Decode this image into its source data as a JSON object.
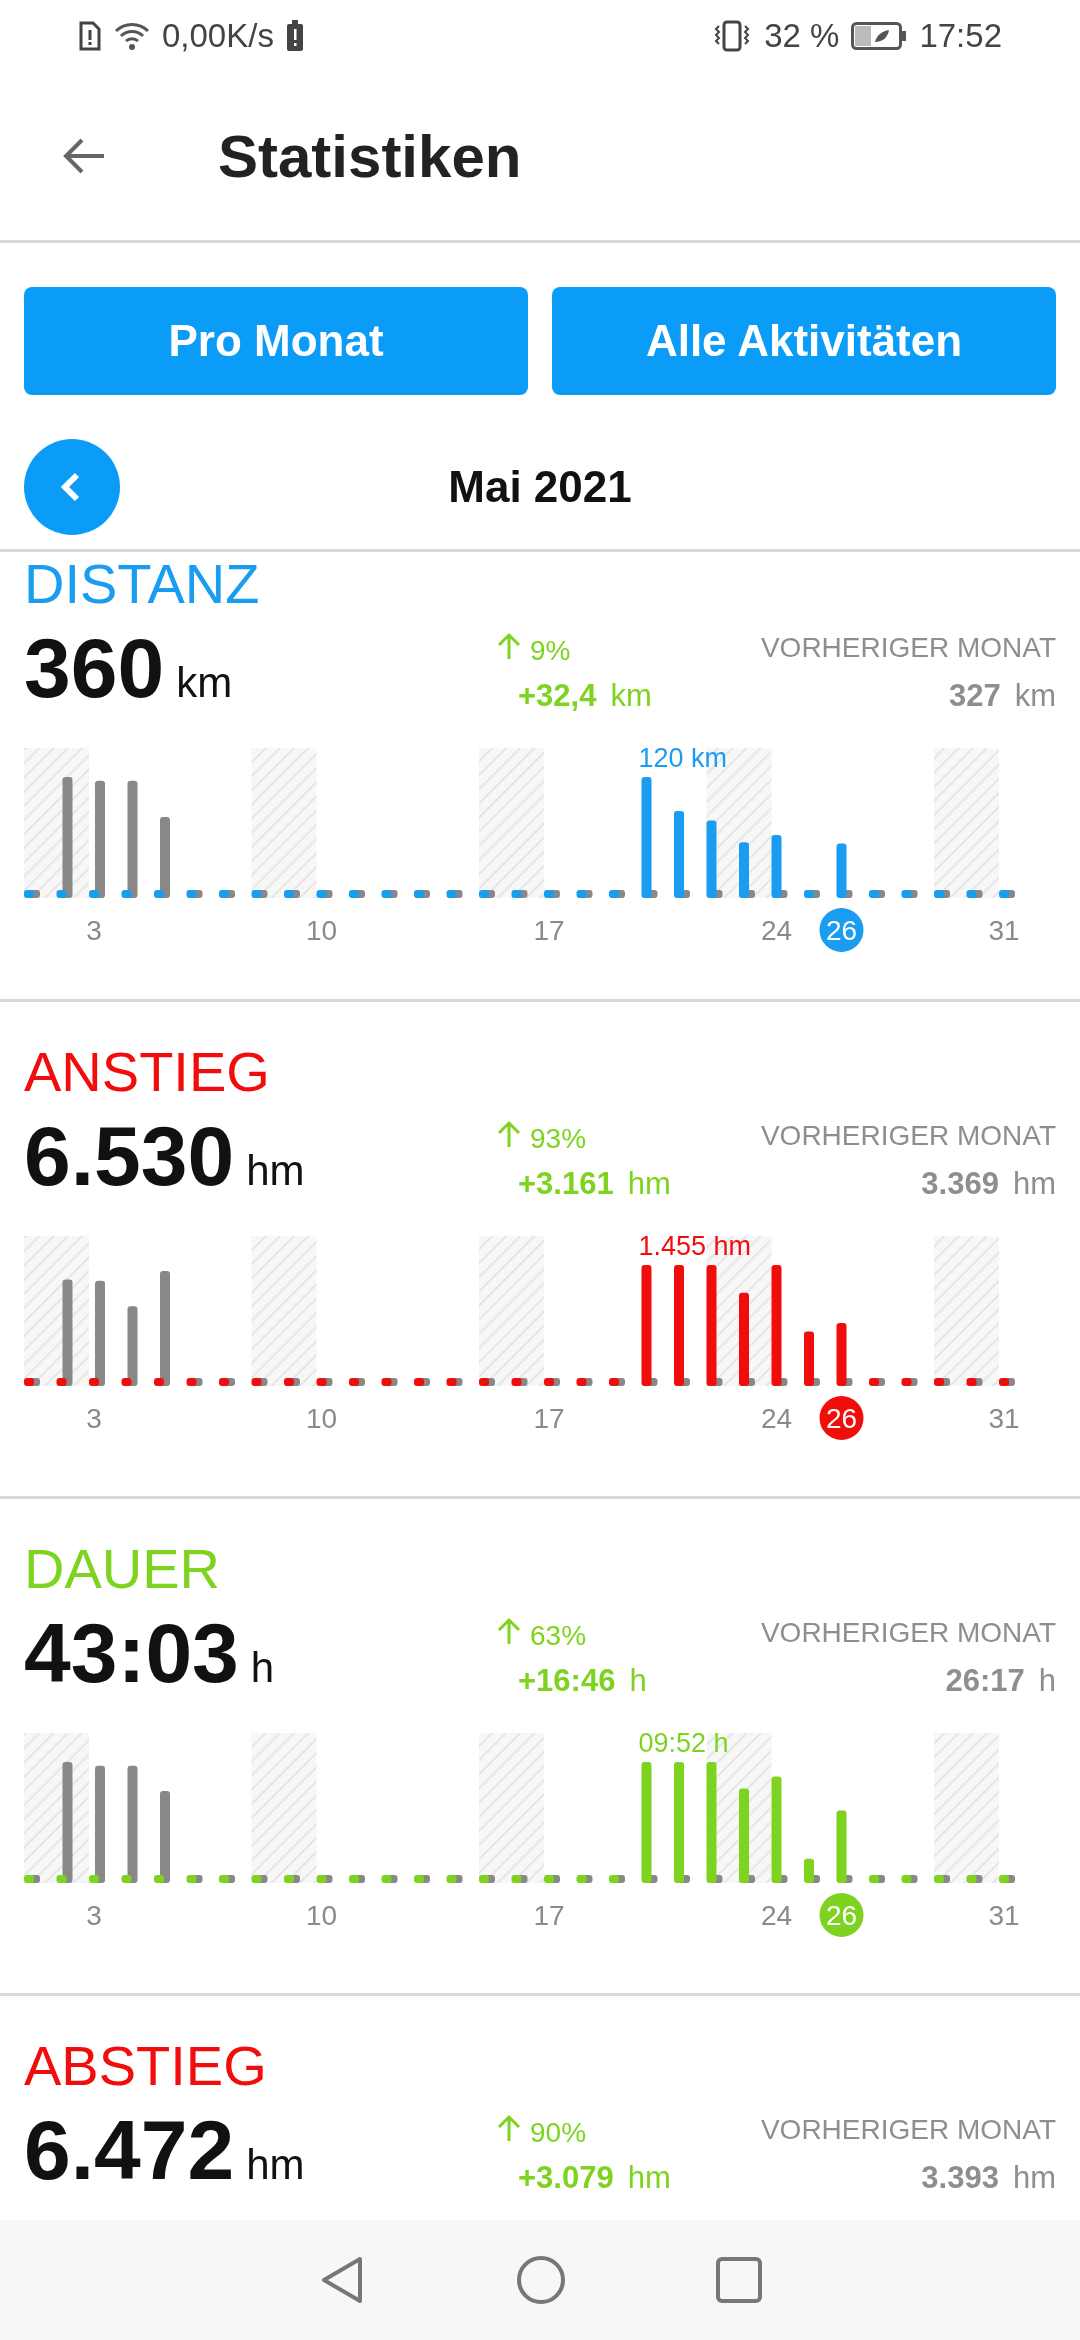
{
  "status_bar": {
    "net_speed": "0,00K/s",
    "battery": "32 %",
    "time": "17:52"
  },
  "app_bar": {
    "title": "Statistiken"
  },
  "buttons": [
    {
      "label": "Pro Monat"
    },
    {
      "label": "Alle Aktivitäten"
    }
  ],
  "period": {
    "label": "Mai 2021"
  },
  "sections": [
    {
      "title": "DISTANZ",
      "color": "#1a9cf0",
      "value": "360",
      "unit": "km",
      "change_pct": "9%",
      "change_value": "+32,4",
      "change_unit": "km",
      "previous_label": "VORHERIGER MONAT",
      "previous_value": "327",
      "previous_unit": "km",
      "peak_label": "120 km",
      "ticks": [
        {
          "label": "3",
          "selected": false
        },
        {
          "label": "10",
          "selected": false
        },
        {
          "label": "17",
          "selected": false
        },
        {
          "label": "24",
          "selected": false
        },
        {
          "label": "26",
          "selected": true
        },
        {
          "label": "31",
          "selected": false
        }
      ]
    },
    {
      "title": "ANSTIEG",
      "color": "#f20d0d",
      "value": "6.530",
      "unit": "hm",
      "change_pct": "93%",
      "change_value": "+3.161",
      "change_unit": "hm",
      "previous_label": "VORHERIGER MONAT",
      "previous_value": "3.369",
      "previous_unit": "hm",
      "peak_label": "1.455 hm",
      "ticks": [
        {
          "label": "3",
          "selected": false
        },
        {
          "label": "10",
          "selected": false
        },
        {
          "label": "17",
          "selected": false
        },
        {
          "label": "24",
          "selected": false
        },
        {
          "label": "26",
          "selected": true
        },
        {
          "label": "31",
          "selected": false
        }
      ]
    },
    {
      "title": "DAUER",
      "color": "#7ed321",
      "value": "43:03",
      "unit": "h",
      "change_pct": "63%",
      "change_value": "+16:46",
      "change_unit": "h",
      "previous_label": "VORHERIGER MONAT",
      "previous_value": "26:17",
      "previous_unit": "h",
      "peak_label": "09:52 h",
      "ticks": [
        {
          "label": "3",
          "selected": false
        },
        {
          "label": "10",
          "selected": false
        },
        {
          "label": "17",
          "selected": false
        },
        {
          "label": "24",
          "selected": false
        },
        {
          "label": "26",
          "selected": true
        },
        {
          "label": "31",
          "selected": false
        }
      ]
    },
    {
      "title": "ABSTIEG",
      "color": "#f20d0d",
      "value": "6.472",
      "unit": "hm",
      "change_pct": "90%",
      "change_value": "+3.079",
      "change_unit": "hm",
      "previous_label": "VORHERIGER MONAT",
      "previous_value": "3.393",
      "previous_unit": "hm"
    }
  ]
}
